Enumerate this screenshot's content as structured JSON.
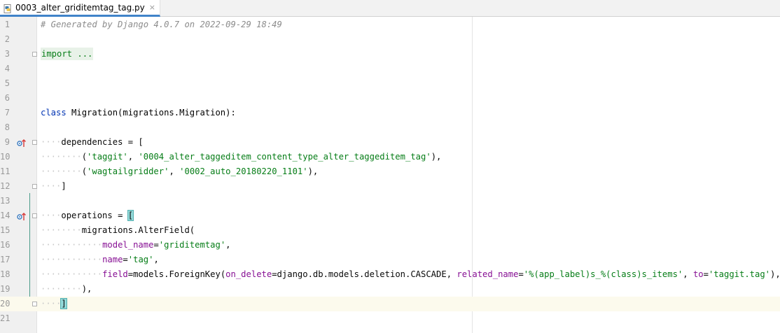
{
  "tab": {
    "title": "0003_alter_griditemtag_tag.py",
    "close": "×",
    "icon": "python-file-icon"
  },
  "editor": {
    "line_numbers": [
      "1",
      "2",
      "3",
      "4",
      "5",
      "6",
      "7",
      "8",
      "9",
      "10",
      "11",
      "12",
      "13",
      "14",
      "15",
      "16",
      "17",
      "18",
      "19",
      "20",
      "21"
    ],
    "comment": "# Generated by Django 4.0.7 on 2022-09-29 18:49",
    "import_folded": "import ...",
    "class_kw": "class",
    "class_decl": " Migration(migrations.Migration):",
    "deps_name": "dependencies = [",
    "dep1_open": "(",
    "dep1_a": "'taggit'",
    "dep1_sep": ", ",
    "dep1_b": "'0004_alter_taggeditem_content_type_alter_taggeditem_tag'",
    "dep1_close": "),",
    "dep2_open": "(",
    "dep2_a": "'wagtailgridder'",
    "dep2_sep": ", ",
    "dep2_b": "'0002_auto_20180220_1101'",
    "dep2_close": "),",
    "deps_close": "]",
    "ops_name": "operations = ",
    "ops_open": "[",
    "alter_field": "migrations.AlterField(",
    "model_name_kw": "model_name",
    "model_name_val": "'griditemtag'",
    "name_kw": "name",
    "name_val": "'tag'",
    "field_kw": "field",
    "field_call": "=models.ForeignKey(",
    "on_delete_kw": "on_delete",
    "on_delete_val": "=django.db.models.deletion.CASCADE, ",
    "related_name_kw": "related_name",
    "related_name_val": "'%(app_label)s_%(class)s_items'",
    "to_sep": ", ",
    "to_kw": "to",
    "to_val": "'taggit.tag'",
    "field_close": "),",
    "alter_close": "),",
    "ops_close": "]"
  },
  "colors": {
    "keyword": "#0033b3",
    "string": "#067d17",
    "named_arg": "#871094",
    "comment": "#8c8c8c",
    "current_line": "#fcfaed",
    "bracket_match": "#93d9d9",
    "tab_underline": "#4083c9"
  }
}
